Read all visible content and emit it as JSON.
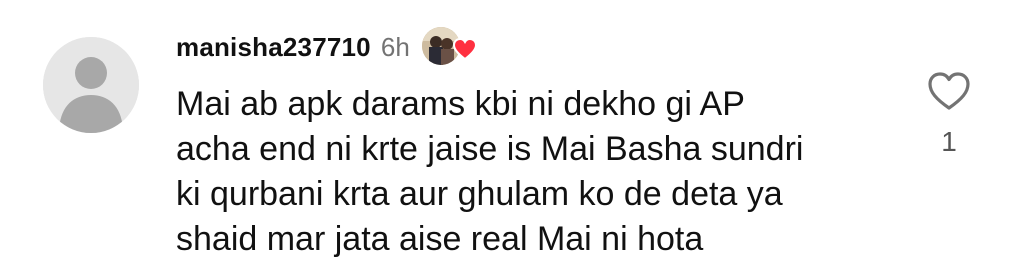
{
  "comment": {
    "username": "manisha237710",
    "timestamp": "6h",
    "text_lines": [
      "Mai ab apk darams kbi ni dekho gi AP",
      "acha end ni krte jaise is Mai Basha sundri",
      "ki qurbani krta aur ghulam ko de deta ya",
      "shaid mar jata aise real Mai ni hota"
    ],
    "like_count": "1",
    "liked_by_creator": true
  },
  "icons": {
    "avatar": "default-user-avatar",
    "creator_badge": "creator-profile-photo",
    "creator_heart": "heart-filled-icon",
    "like": "heart-outline-icon"
  },
  "colors": {
    "heart_red": "#ff3040",
    "timestamp_gray": "#737373",
    "avatar_bg": "#e6e6e6",
    "avatar_fg": "#a8a8a8"
  }
}
